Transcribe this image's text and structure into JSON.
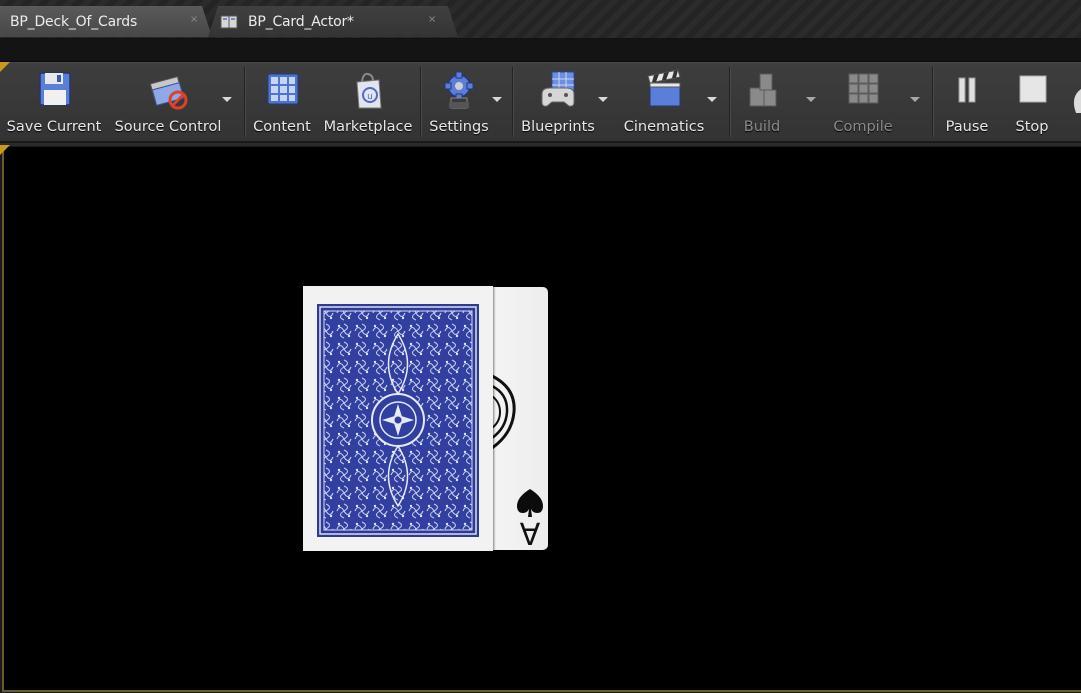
{
  "tabs": [
    {
      "label": "BP_Deck_Of_Cards",
      "active": false,
      "close": "×"
    },
    {
      "label": "BP_Card_Actor*",
      "active": true,
      "close": "×"
    }
  ],
  "toolbar": {
    "save_current": "Save Current",
    "source_control": "Source Control",
    "content": "Content",
    "marketplace": "Marketplace",
    "settings": "Settings",
    "blueprints": "Blueprints",
    "cinematics": "Cinematics",
    "build": "Build",
    "compile": "Compile",
    "pause": "Pause",
    "stop": "Stop"
  },
  "viewport": {
    "card_rank": "A",
    "card_suit": "spade"
  },
  "colors": {
    "accent": "#c79a1e",
    "card_pattern": "#2e3a94",
    "viewport_bg": "#000000"
  }
}
